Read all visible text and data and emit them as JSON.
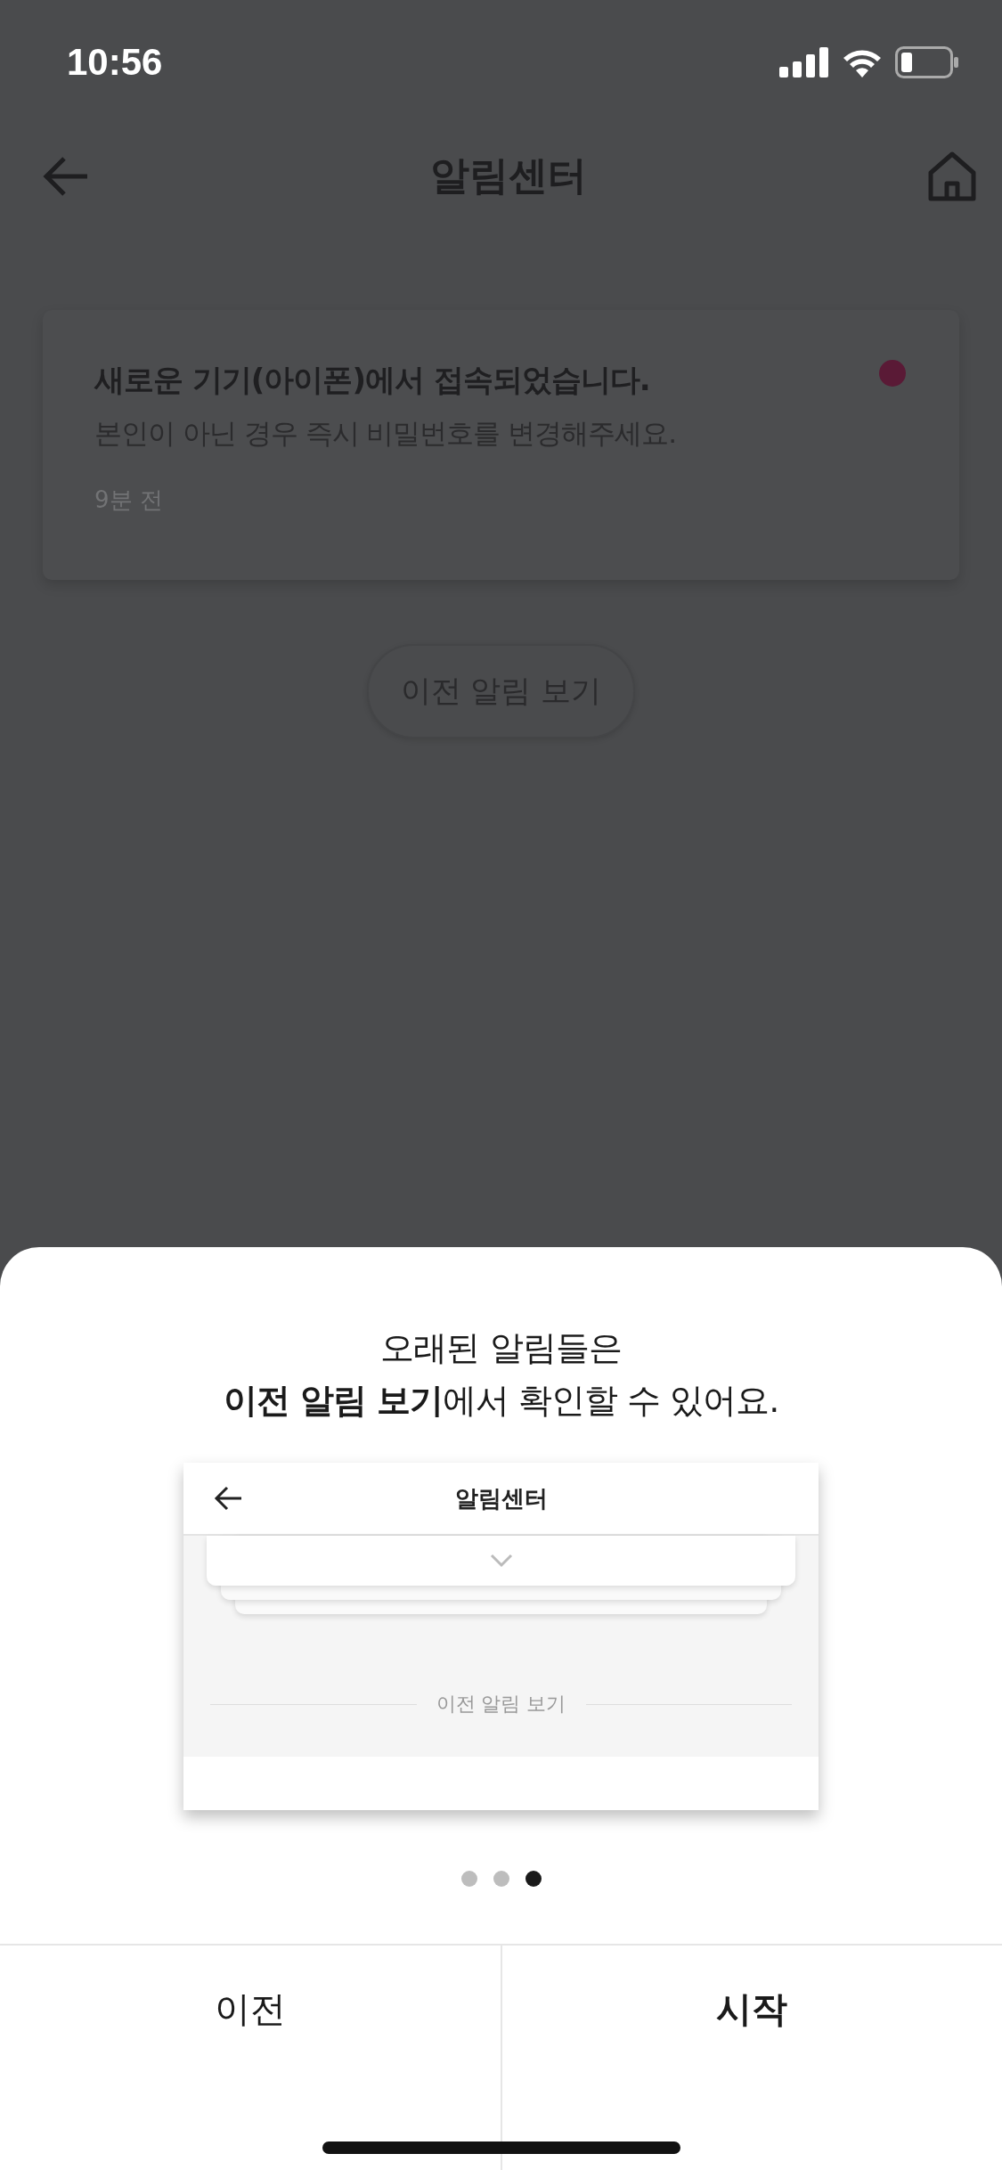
{
  "status_bar": {
    "time": "10:56"
  },
  "header": {
    "title": "알림센터"
  },
  "notifications": [
    {
      "title": "새로운 기기(아이폰)에서 접속되었습니다.",
      "body": "본인이 아닌 경우 즉시 비밀번호를 변경해주세요.",
      "time": "9분 전",
      "unread": true
    }
  ],
  "previous_button": {
    "label": "이전 알림 보기"
  },
  "sheet": {
    "title_lines": [
      "오래된 알림들은",
      "**이전 알림 보기**에서 확인할 수 있어요."
    ],
    "preview": {
      "title": "알림센터",
      "divider_label": "이전 알림 보기"
    },
    "pages": [
      {
        "selected": false
      },
      {
        "selected": false
      },
      {
        "selected": true
      }
    ],
    "buttons": [
      {
        "label": "이전",
        "kind": "secondary"
      },
      {
        "label": "시작",
        "kind": "primary"
      }
    ]
  }
}
